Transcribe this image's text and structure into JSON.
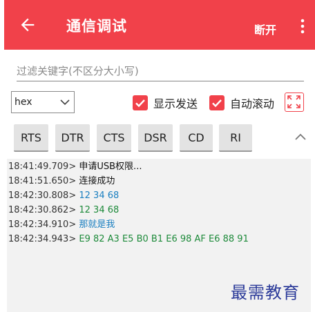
{
  "appbar": {
    "title": "通信调试",
    "action": "断开"
  },
  "filter": {
    "placeholder": "过滤关键字(不区分大小写)"
  },
  "format_select": {
    "value": "hex"
  },
  "options": {
    "show_sent": "显示发送",
    "auto_scroll": "自动滚动"
  },
  "signals": [
    "RTS",
    "DTR",
    "CTS",
    "DSR",
    "CD",
    "RI"
  ],
  "log": [
    {
      "ts": "18:41:49.709>",
      "msg": "申请USB权限...",
      "kind": "sys"
    },
    {
      "ts": "18:41:51.650>",
      "msg": "连接成功",
      "kind": "sys"
    },
    {
      "ts": "18:42:30.808>",
      "msg": "12 34 68",
      "kind": "tx"
    },
    {
      "ts": "18:42:30.862>",
      "msg": "12 34 68",
      "kind": "rx"
    },
    {
      "ts": "18:42:34.910>",
      "msg": "那就是我",
      "kind": "tx"
    },
    {
      "ts": "18:42:34.943>",
      "msg": "E9 82 A3 E5 B0 B1 E6 98 AF E6 88 91",
      "kind": "rx"
    }
  ],
  "watermark": "最需教育",
  "colors": {
    "accent": "#f1414a",
    "tx": "#1a7fc0",
    "rx": "#1d8a3a"
  },
  "icons": [
    "back-arrow-icon",
    "more-vert-icon",
    "dropdown-arrow-icon",
    "check-icon",
    "fullscreen-icon",
    "chevron-up-icon"
  ]
}
